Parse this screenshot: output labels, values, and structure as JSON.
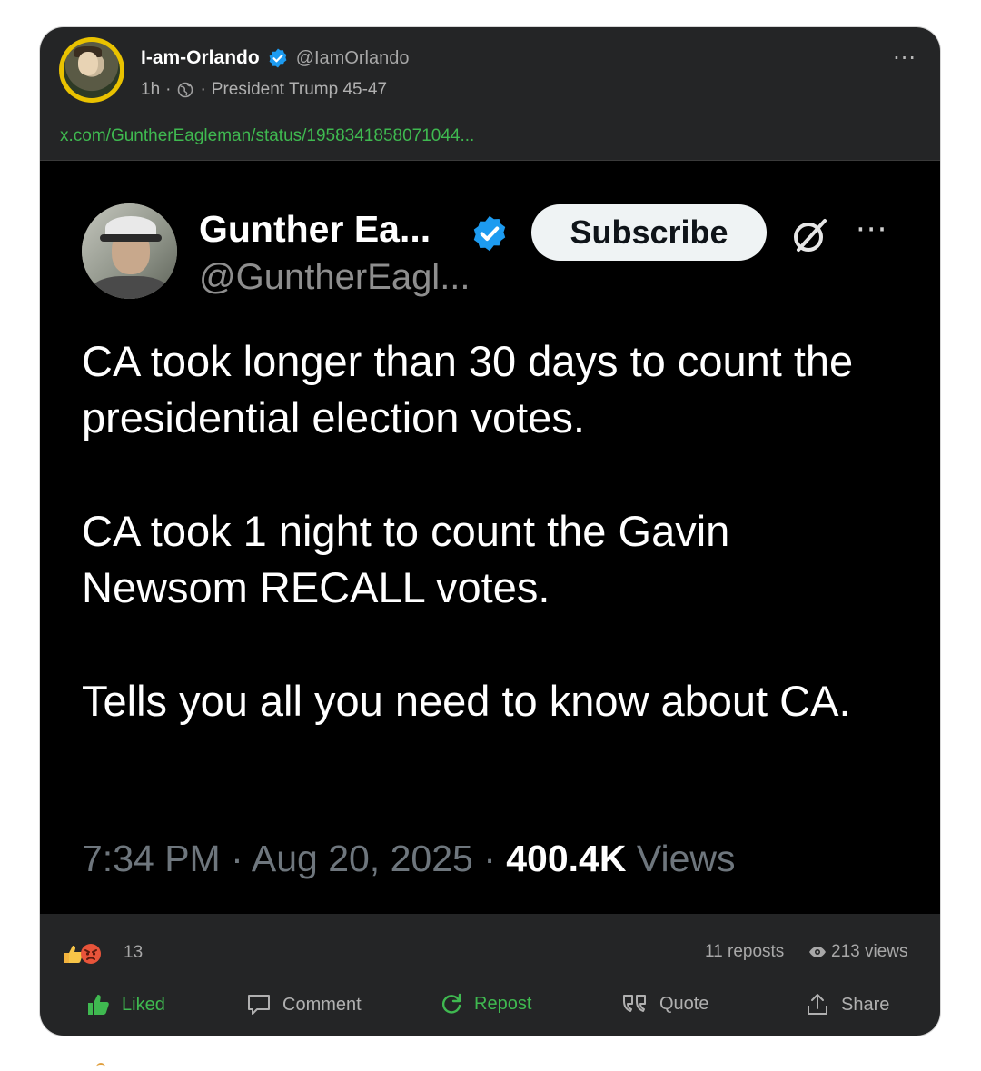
{
  "post": {
    "author_name": "I-am-Orlando",
    "author_handle": "@IamOrlando",
    "time": "1h",
    "separator": "·",
    "audience": "President Trump 45-47",
    "link": "x.com/GuntherEagleman/status/1958341858071044...",
    "more": "···"
  },
  "tweet": {
    "name": "Gunther Ea...",
    "handle": "@GuntherEagl...",
    "subscribe_label": "Subscribe",
    "more": "···",
    "paragraphs": [
      "CA took longer than 30 days to count the presidential election votes.",
      "CA took 1 night to count the Gavin Newsom RECALL votes.",
      "Tells you all you need to know about CA."
    ],
    "timestamp": "7:34 PM · Aug 20, 2025 · ",
    "views_number": "400.4K",
    "views_label": " Views"
  },
  "stats": {
    "reactions_count": "13",
    "reposts": "11 reposts",
    "views": "213 views"
  },
  "actions": {
    "liked": "Liked",
    "comment": "Comment",
    "repost": "Repost",
    "quote": "Quote",
    "share": "Share"
  },
  "colors": {
    "card_bg": "#242526",
    "embed_bg": "#000000",
    "accent_green": "#3fb950",
    "verified_blue": "#1d9bf0"
  }
}
